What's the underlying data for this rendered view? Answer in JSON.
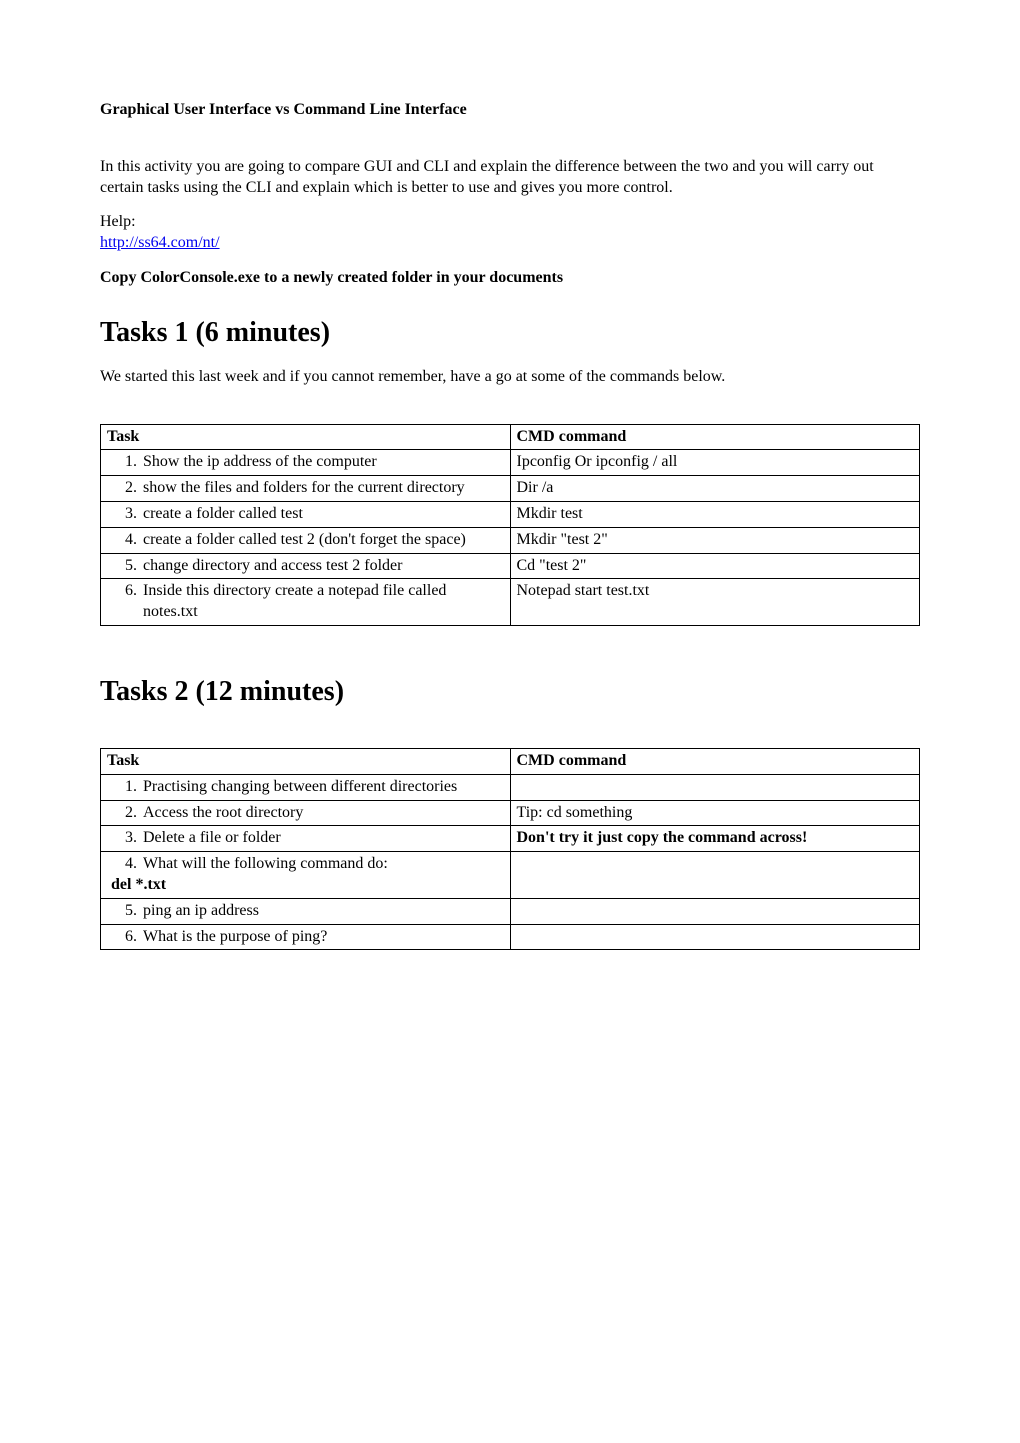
{
  "heading": "Graphical User Interface vs Command Line Interface",
  "intro": "In this activity you are going to compare GUI and CLI and explain the difference between the two and you will carry out certain tasks using the CLI and explain which is better to use and gives you more control.",
  "help_label": "Help:",
  "help_link_text": "http://ss64.com/nt/",
  "copy_instruction": "Copy ColorConsole.exe to a newly created folder in your documents",
  "tasks1_title": "Tasks 1 (6 minutes)",
  "tasks1_intro": "We started this last week and if you cannot remember, have a go at some of the commands below.",
  "table_headers": {
    "task": "Task",
    "cmd": "CMD command"
  },
  "tasks1": [
    {
      "num": "1.",
      "task": "Show the ip address of the computer",
      "cmd": "Ipconfig Or ipconfig / all"
    },
    {
      "num": "2.",
      "task": "show the files and folders for the current directory",
      "cmd": "Dir /a"
    },
    {
      "num": "3.",
      "task": "create a folder called test",
      "cmd": "Mkdir test"
    },
    {
      "num": "4.",
      "task": "create a folder called test 2 (don't forget the space)",
      "cmd": "Mkdir \"test 2\""
    },
    {
      "num": "5.",
      "task": "change directory and access test 2 folder",
      "cmd": "Cd \"test 2\""
    },
    {
      "num": "6.",
      "task": "Inside this directory create a notepad file called notes.txt",
      "cmd": "Notepad start test.txt"
    }
  ],
  "tasks2_title": "Tasks 2 (12 minutes)",
  "tasks2": [
    {
      "num": "1.",
      "task": "Practising changing between different directories",
      "cmd": "",
      "cmd_bold": false,
      "extra": ""
    },
    {
      "num": "2.",
      "task": "Access the root directory",
      "cmd": "Tip: cd something",
      "cmd_bold": false,
      "extra": ""
    },
    {
      "num": "3.",
      "task": "Delete a file or folder",
      "cmd": "Don't try it just copy the command across!",
      "cmd_bold": true,
      "extra": ""
    },
    {
      "num": "4.",
      "task": "What will the following command do:",
      "cmd": "",
      "cmd_bold": false,
      "extra": "del *.txt"
    },
    {
      "num": "5.",
      "task": "ping an ip address",
      "cmd": "",
      "cmd_bold": false,
      "extra": ""
    },
    {
      "num": "6.",
      "task": "What is the purpose of ping?",
      "cmd": "",
      "cmd_bold": false,
      "extra": ""
    }
  ]
}
